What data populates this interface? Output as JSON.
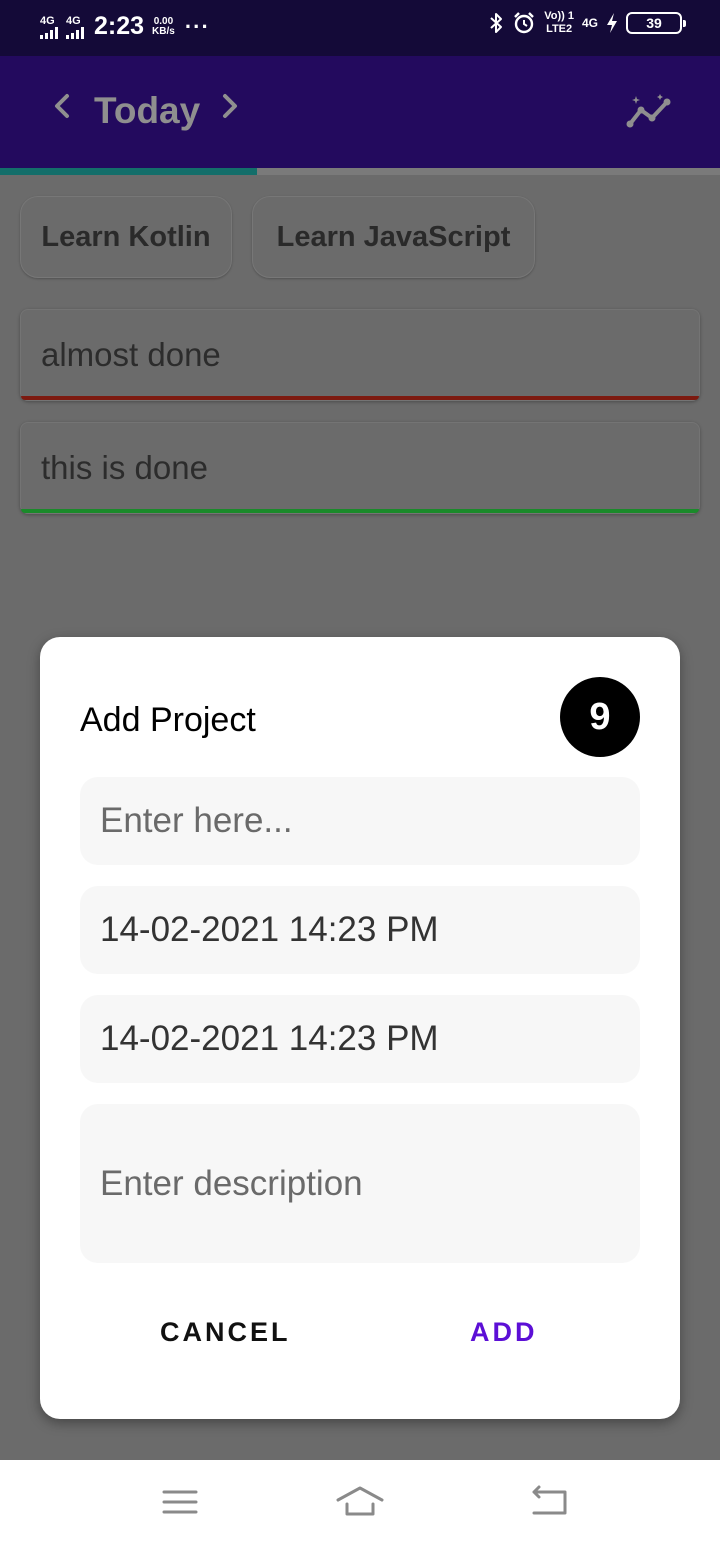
{
  "status_bar": {
    "network1": "4G",
    "network2": "4G",
    "time": "2:23",
    "speed_value": "0.00",
    "speed_unit": "KB/s",
    "more": "···",
    "volte_top": "Vo)) 1",
    "volte_bottom": "LTE2",
    "network3": "4G",
    "battery": "39"
  },
  "app_bar": {
    "title": "Today",
    "progress_fraction": 0.357
  },
  "chips": [
    "Learn Kotlin",
    "Learn JavaScript"
  ],
  "tasks": [
    {
      "text": "almost done",
      "status_color": "#7d1a10"
    },
    {
      "text": "this is done",
      "status_color": "#1a8a2a"
    }
  ],
  "dialog": {
    "title": "Add Project",
    "count": "9",
    "name_placeholder": "Enter here...",
    "start_datetime": "14-02-2021 14:23 PM",
    "end_datetime": "14-02-2021 14:23 PM",
    "description_placeholder": "Enter description",
    "cancel_label": "CANCEL",
    "add_label": "ADD"
  },
  "colors": {
    "accent": "#5c0fd6",
    "app_bar": "#230a5e",
    "status_bar": "#140a38"
  }
}
